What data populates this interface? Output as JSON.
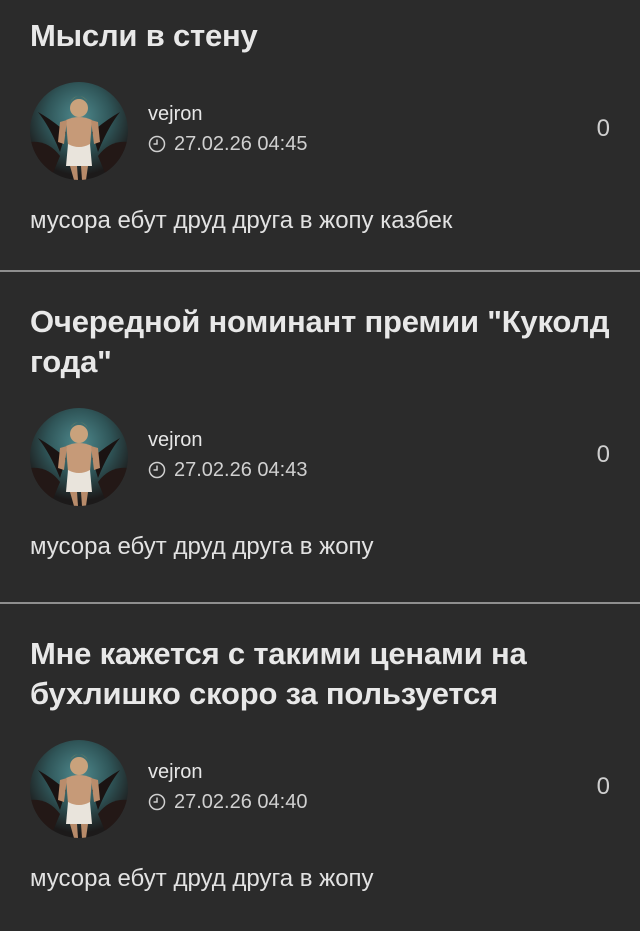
{
  "posts": [
    {
      "title": "Мысли в стену",
      "author": "vejron",
      "time": "27.02.26 04:45",
      "score": "0",
      "body": "мусора ебут друд друга в жопу казбек"
    },
    {
      "title": "Очередной номинант премии \"Куколд года\"",
      "author": "vejron",
      "time": "27.02.26 04:43",
      "score": "0",
      "body": "мусора ебут друд друга в жопу"
    },
    {
      "title": "Мне кажется с такими ценами на бухлишко скоро за пользуется",
      "author": "vejron",
      "time": "27.02.26 04:40",
      "score": "0",
      "body": "мусора ебут друд друга в жопу"
    }
  ],
  "icons": {
    "clock": "clock-icon",
    "avatar": "angel-figure-avatar"
  },
  "colors": {
    "background": "#2b2b2b",
    "divider": "#8f8f8f",
    "text": "#e6e6e6"
  }
}
